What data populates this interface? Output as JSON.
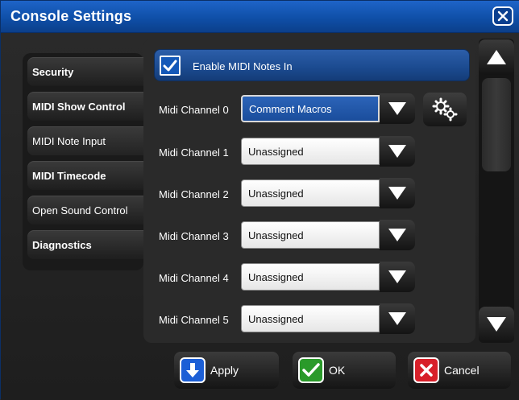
{
  "window": {
    "title": "Console Settings"
  },
  "tabs": [
    {
      "label": "Security"
    },
    {
      "label": "MIDI Show Control"
    },
    {
      "label": "MIDI Note Input"
    },
    {
      "label": "MIDI Timecode"
    },
    {
      "label": "Open Sound Control"
    },
    {
      "label": "Diagnostics"
    }
  ],
  "active_tab": "MIDI Note Input",
  "enable": {
    "label": "Enable MIDI Notes In",
    "checked": true
  },
  "channels": [
    {
      "label": "Midi Channel 0",
      "value": "Comment Macros"
    },
    {
      "label": "Midi Channel 1",
      "value": "Unassigned"
    },
    {
      "label": "Midi Channel 2",
      "value": "Unassigned"
    },
    {
      "label": "Midi Channel 3",
      "value": "Unassigned"
    },
    {
      "label": "Midi Channel 4",
      "value": "Unassigned"
    },
    {
      "label": "Midi Channel 5",
      "value": "Unassigned"
    }
  ],
  "footer": {
    "apply": "Apply",
    "ok": "OK",
    "cancel": "Cancel"
  },
  "colors": {
    "title_blue": "#0f4fa8",
    "selected_blue": "#1a4d9c",
    "apply_icon": "#1c5fd6",
    "ok_icon": "#2a9a2a",
    "cancel_icon": "#d8202a"
  },
  "icons": {
    "close": "close-icon",
    "check": "check-icon",
    "dropdown": "triangle-down-icon",
    "gear": "gears-icon",
    "scroll_up": "triangle-up-icon",
    "scroll_down": "triangle-down-icon",
    "apply": "arrow-down-icon",
    "ok": "check-icon",
    "cancel": "x-icon"
  }
}
